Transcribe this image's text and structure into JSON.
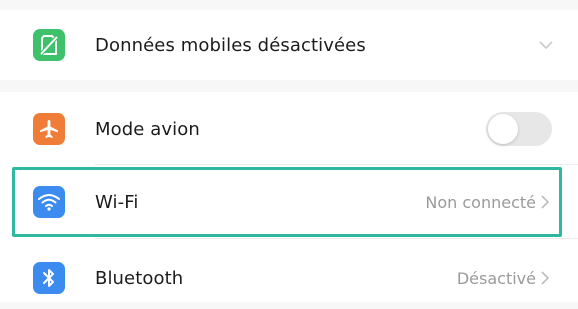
{
  "settings": {
    "mobile_data": {
      "label": "Données mobiles désactivées",
      "icon": "sim-card-icon",
      "icon_color": "#3fc16b"
    },
    "airplane_mode": {
      "label": "Mode avion",
      "icon": "airplane-icon",
      "icon_color": "#ef7d37",
      "toggle_on": false
    },
    "wifi": {
      "label": "Wi-Fi",
      "value": "Non connecté",
      "icon": "wifi-icon",
      "icon_color": "#3c8cf0",
      "highlighted": true
    },
    "bluetooth": {
      "label": "Bluetooth",
      "value": "Désactivé",
      "icon": "bluetooth-icon",
      "icon_color": "#3c8cf0"
    }
  },
  "colors": {
    "highlight_border": "#2fb8a0",
    "background": "#f7f7f7"
  }
}
